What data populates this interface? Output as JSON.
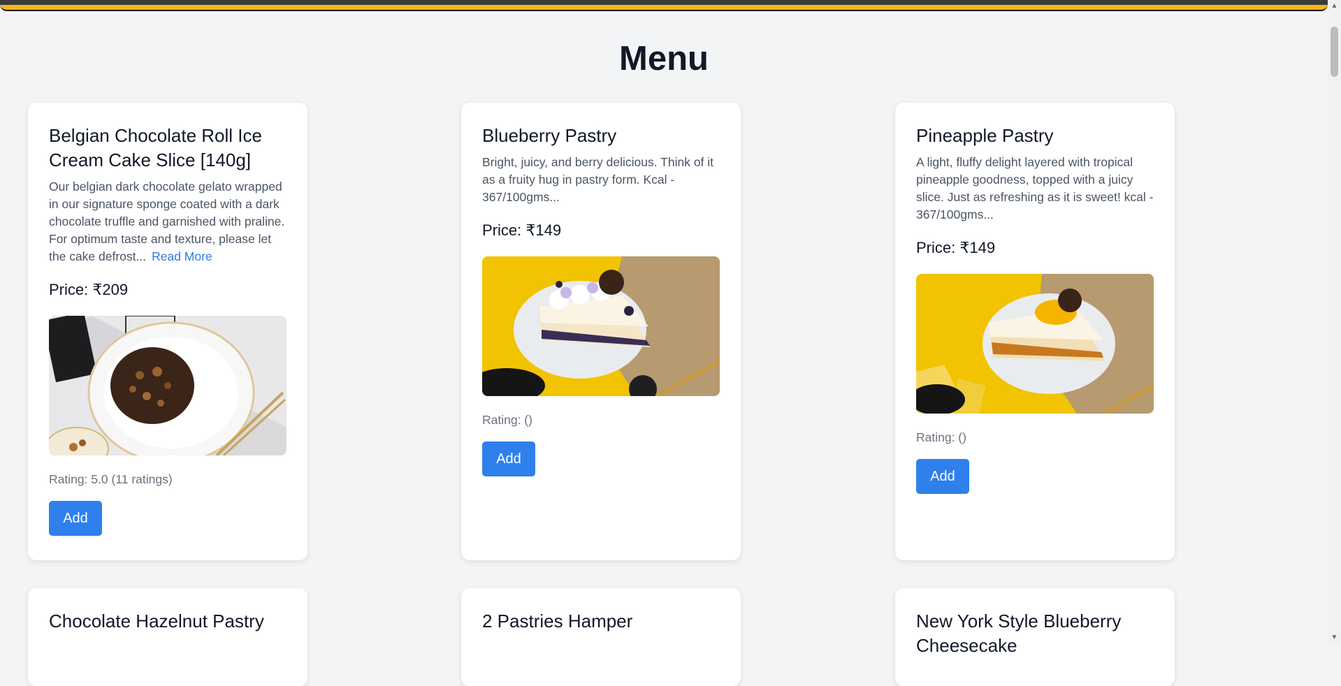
{
  "page": {
    "title": "Menu"
  },
  "colors": {
    "accent": "#2f80ed",
    "link": "#2f7ae5",
    "topbar": "#f6b61e",
    "background": "#f3f4f6"
  },
  "products": [
    {
      "name": "Belgian Chocolate Roll Ice Cream Cake Slice [140g]",
      "description": "Our belgian dark chocolate gelato wrapped in our signature sponge coated with a dark chocolate truffle and garnished with praline. For optimum taste and texture, please let the cake defrost...",
      "read_more": "Read More",
      "price": "Price: ₹209",
      "rating": "Rating: 5.0 (11 ratings)",
      "add_label": "Add"
    },
    {
      "name": "Blueberry Pastry",
      "description": "Bright, juicy, and berry delicious. Think of it as a fruity hug in pastry form. Kcal - 367/100gms...",
      "price": "Price: ₹149",
      "rating": "Rating: ()",
      "add_label": "Add"
    },
    {
      "name": "Pineapple Pastry",
      "description": "A light, fluffy delight layered with tropical pineapple goodness, topped with a juicy slice. Just as refreshing as it is sweet! kcal - 367/100gms...",
      "price": "Price: ₹149",
      "rating": "Rating: ()",
      "add_label": "Add"
    },
    {
      "name": "Chocolate Hazelnut Pastry"
    },
    {
      "name": "2 Pastries Hamper"
    },
    {
      "name": "New York Style Blueberry Cheesecake"
    }
  ],
  "icons": {
    "scroll_up": "triangle-up-icon",
    "scroll_down": "triangle-down-icon"
  }
}
